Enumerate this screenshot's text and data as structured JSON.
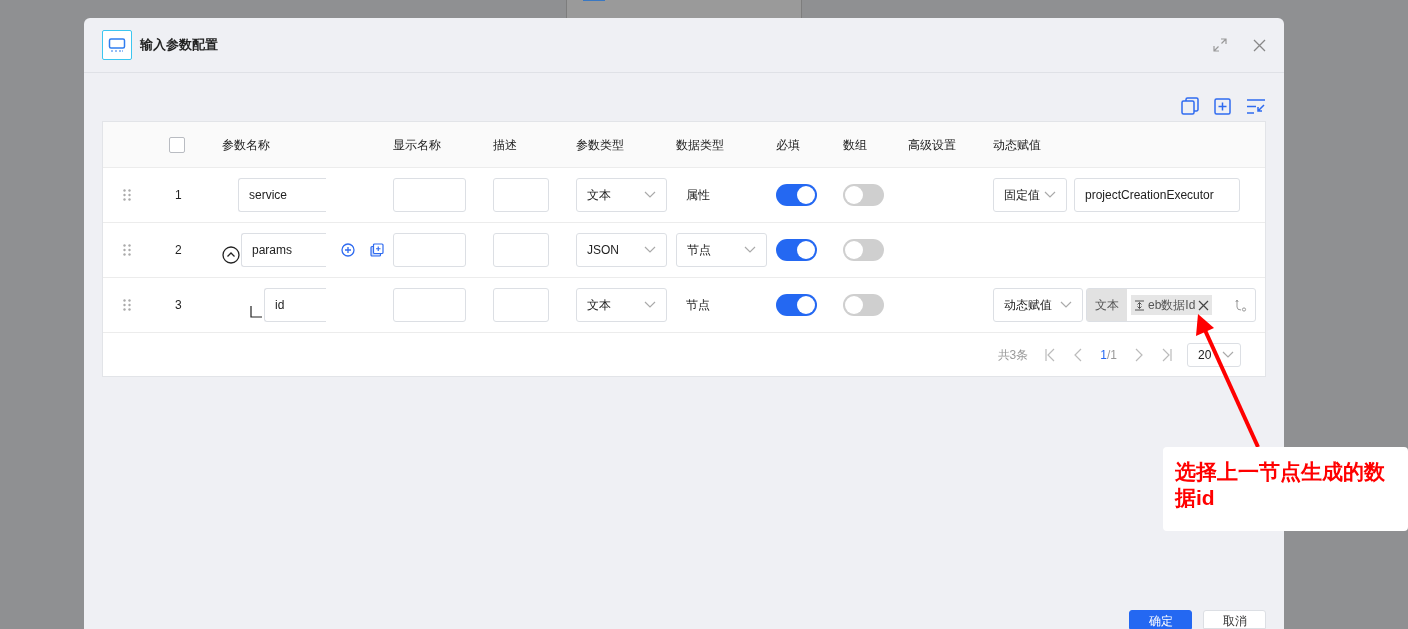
{
  "dialog": {
    "title": "输入参数配置"
  },
  "table": {
    "columns": [
      "参数名称",
      "显示名称",
      "描述",
      "参数类型",
      "数据类型",
      "必填",
      "数组",
      "高级设置",
      "动态赋值"
    ],
    "select_all": {
      "checked": false
    },
    "rows": [
      {
        "index": "1",
        "name": "service",
        "param_type": "文本",
        "data_type": {
          "kind": "text",
          "value": "属性"
        },
        "required": {
          "on": true
        },
        "array": {
          "on": false
        },
        "dynamic": {
          "kind": "fixed",
          "mode": "固定值",
          "value": "projectCreationExecutor"
        }
      },
      {
        "index": "2",
        "name": "params",
        "expanded": true,
        "param_type": "JSON",
        "data_type": {
          "kind": "select",
          "value": "节点"
        },
        "required": {
          "on": true
        },
        "array": {
          "on": false
        },
        "children": [
          {
            "index": "3",
            "name": "id",
            "param_type": "文本",
            "data_type": {
              "kind": "text",
              "value": "节点"
            },
            "required": {
              "on": true
            },
            "array": {
              "on": false
            },
            "dynamic": {
              "kind": "dynamic",
              "mode": "动态赋值",
              "source_label": "文本",
              "tag": "eb数据Id"
            }
          }
        ]
      }
    ]
  },
  "pagination": {
    "total": "共3条",
    "current": "1",
    "separator": "/",
    "pages": "1",
    "page_size": "20"
  },
  "buttons": [
    {
      "label": "确定",
      "kind": "primary"
    },
    {
      "label": "取消",
      "kind": "secondary"
    }
  ],
  "annotation": {
    "text": "选择上一节点生成的数据id"
  }
}
